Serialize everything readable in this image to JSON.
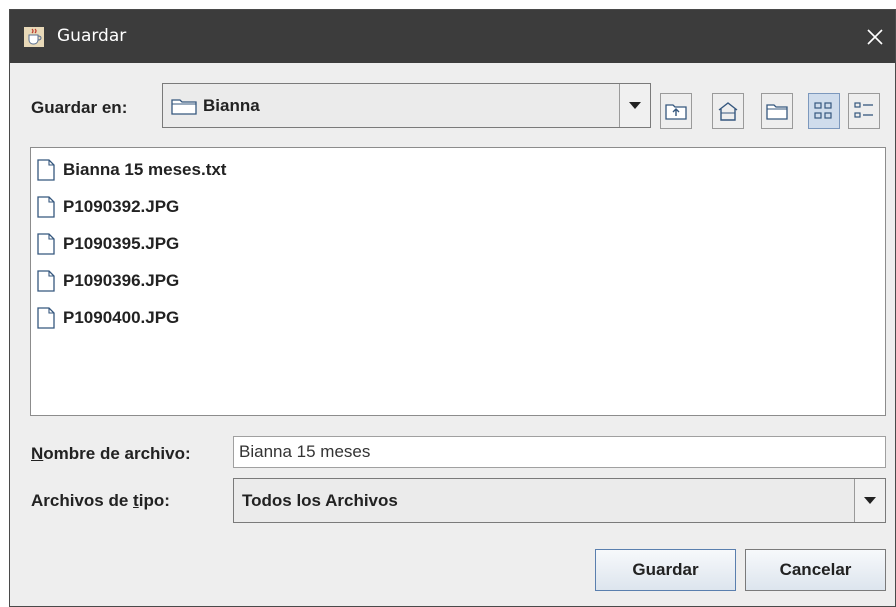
{
  "window": {
    "title": "Guardar"
  },
  "toolbar": {
    "look_in_label": "Guardar en:",
    "look_in_value": "Bianna",
    "buttons": [
      "up-one-level",
      "home",
      "new-folder",
      "list-view",
      "details-view"
    ]
  },
  "files": [
    {
      "name": "Bianna 15 meses.txt"
    },
    {
      "name": "P1090392.JPG"
    },
    {
      "name": "P1090395.JPG"
    },
    {
      "name": "P1090396.JPG"
    },
    {
      "name": "P1090400.JPG"
    }
  ],
  "filename": {
    "label_mnemonic": "N",
    "label_rest": "ombre de archivo:",
    "value": "Bianna 15 meses"
  },
  "filetype": {
    "label_pre": "Archivos de ",
    "label_mnemonic": "t",
    "label_post": "ipo:",
    "value": "Todos los Archivos"
  },
  "actions": {
    "save_label": "Guardar",
    "cancel_label": "Cancelar"
  }
}
